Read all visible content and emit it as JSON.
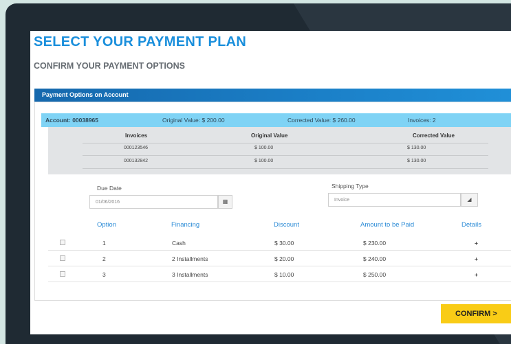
{
  "page": {
    "title": "SELECT YOUR PAYMENT PLAN",
    "subtitle": "CONFIRM YOUR PAYMENT OPTIONS"
  },
  "panel": {
    "header": "Payment Options on Account"
  },
  "account": {
    "number_label": "Account: 00038965",
    "original_value": "Original Value: $ 200.00",
    "corrected_value": "Corrected Value:  $ 260.00",
    "invoices": "Invoices: 2"
  },
  "invoice_table": {
    "headers": [
      "Invoices",
      "Original Value",
      "Corrected Value"
    ],
    "rows": [
      [
        "000123546",
        "$ 100.00",
        "$ 130.00"
      ],
      [
        "000132842",
        "$ 100.00",
        "$ 130.00"
      ]
    ]
  },
  "form": {
    "due_date_label": "Due Date",
    "due_date_value": "01/06/2016",
    "shipping_type_label": "Shipping Type",
    "shipping_type_value": "Invoice"
  },
  "options_table": {
    "headers": [
      "Option",
      "Financing",
      "Discount",
      "Amount to be Paid",
      "Details"
    ],
    "rows": [
      [
        "1",
        "Cash",
        "$ 30.00",
        "$ 230.00",
        "+"
      ],
      [
        "2",
        "2 Installments",
        "$ 20.00",
        "$ 240.00",
        "+"
      ],
      [
        "3",
        "3 Installments",
        "$ 10.00",
        "$ 250.00",
        "+"
      ]
    ]
  },
  "confirm_label": "CONFIRM >",
  "icons": {
    "calendar": "calendar-icon",
    "dropdown": "dropdown-icon",
    "expand": "plus-icon"
  },
  "colors": {
    "title_blue": "#1a8fdc",
    "panel_header": "#1b80c8",
    "account_bar": "#7fd3f5",
    "confirm_yellow": "#f9cc16",
    "plus_green": "#2eb82e"
  }
}
